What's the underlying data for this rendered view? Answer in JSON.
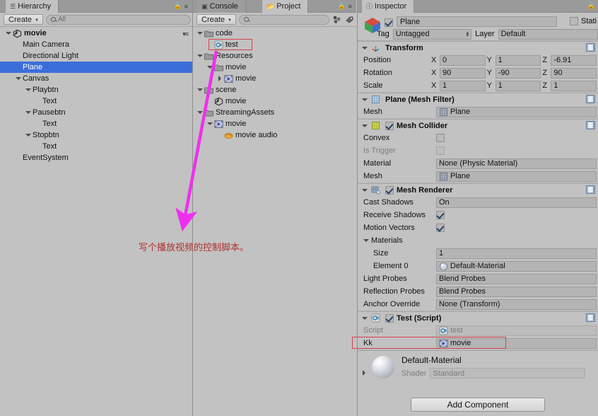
{
  "hierarchy": {
    "tab_label": "Hierarchy",
    "tab_icon": "hierarchy-icon",
    "create_label": "Create",
    "search_placeholder": "All",
    "search_value": "",
    "items": [
      {
        "label": "movie",
        "depth": 0,
        "arrow": "down",
        "icon": "scene-icon",
        "selected": false,
        "bold": true
      },
      {
        "label": "Main Camera",
        "depth": 1,
        "arrow": "none",
        "icon": "none",
        "selected": false,
        "bold": false
      },
      {
        "label": "Directional Light",
        "depth": 1,
        "arrow": "none",
        "icon": "none",
        "selected": false,
        "bold": false
      },
      {
        "label": "Plane",
        "depth": 1,
        "arrow": "none",
        "icon": "none",
        "selected": true,
        "bold": false
      },
      {
        "label": "Canvas",
        "depth": 1,
        "arrow": "down",
        "icon": "none",
        "selected": false,
        "bold": false
      },
      {
        "label": "Playbtn",
        "depth": 2,
        "arrow": "down",
        "icon": "none",
        "selected": false,
        "bold": false
      },
      {
        "label": "Text",
        "depth": 3,
        "arrow": "none",
        "icon": "none",
        "selected": false,
        "bold": false
      },
      {
        "label": "Pausebtn",
        "depth": 2,
        "arrow": "down",
        "icon": "none",
        "selected": false,
        "bold": false
      },
      {
        "label": "Text",
        "depth": 3,
        "arrow": "none",
        "icon": "none",
        "selected": false,
        "bold": false
      },
      {
        "label": "Stopbtn",
        "depth": 2,
        "arrow": "down",
        "icon": "none",
        "selected": false,
        "bold": false
      },
      {
        "label": "Text",
        "depth": 3,
        "arrow": "none",
        "icon": "none",
        "selected": false,
        "bold": false
      },
      {
        "label": "EventSystem",
        "depth": 1,
        "arrow": "none",
        "icon": "none",
        "selected": false,
        "bold": false
      }
    ]
  },
  "project": {
    "tabs": [
      {
        "label": "Console",
        "icon": "console-icon",
        "active": false
      },
      {
        "label": "Project",
        "icon": "project-icon",
        "active": true
      }
    ],
    "create_label": "Create",
    "search_placeholder": "",
    "items": [
      {
        "label": "code",
        "depth": 0,
        "arrow": "down",
        "icon": "folder-icon",
        "highlight": false
      },
      {
        "label": "test",
        "depth": 1,
        "arrow": "none",
        "icon": "csharp-script-icon",
        "highlight": true
      },
      {
        "label": "Resources",
        "depth": 0,
        "arrow": "down",
        "icon": "folder-icon",
        "highlight": false
      },
      {
        "label": "movie",
        "depth": 1,
        "arrow": "down",
        "icon": "folder-icon",
        "highlight": false
      },
      {
        "label": "movie",
        "depth": 2,
        "arrow": "right",
        "icon": "movie-texture-icon",
        "highlight": false
      },
      {
        "label": "scene",
        "depth": 0,
        "arrow": "down",
        "icon": "folder-icon",
        "highlight": false
      },
      {
        "label": "movie",
        "depth": 1,
        "arrow": "none",
        "icon": "scene-icon",
        "highlight": false
      },
      {
        "label": "StreamingAssets",
        "depth": 0,
        "arrow": "down",
        "icon": "folder-icon",
        "highlight": false
      },
      {
        "label": "movie",
        "depth": 1,
        "arrow": "down",
        "icon": "movie-texture-icon",
        "highlight": false
      },
      {
        "label": "movie audio",
        "depth": 2,
        "arrow": "none",
        "icon": "audio-clip-icon",
        "highlight": false
      }
    ]
  },
  "inspector": {
    "tab_label": "Inspector",
    "tab_icon": "inspector-icon",
    "object_name": "Plane",
    "object_enabled": true,
    "static_label": "Stati",
    "static_checked": false,
    "tag_label": "Tag",
    "tag_value": "Untagged",
    "layer_label": "Layer",
    "layer_value": "Default",
    "components": [
      {
        "title": "Transform",
        "icon": "transform-icon",
        "has_checkbox": false,
        "rows": [
          {
            "type": "vector3",
            "label": "Position",
            "x": "0",
            "y": "1",
            "z": "-6.91"
          },
          {
            "type": "vector3",
            "label": "Rotation",
            "x": "90",
            "y": "-90",
            "z": "90"
          },
          {
            "type": "vector3",
            "label": "Scale",
            "x": "1",
            "y": "1",
            "z": "1"
          }
        ]
      },
      {
        "title": "Plane (Mesh Filter)",
        "icon": "mesh-filter-icon",
        "has_checkbox": false,
        "rows": [
          {
            "type": "object",
            "label": "Mesh",
            "value": "Plane",
            "value_icon": "mesh-icon"
          }
        ]
      },
      {
        "title": "Mesh Collider",
        "icon": "mesh-collider-icon",
        "has_checkbox": true,
        "checked": true,
        "rows": [
          {
            "type": "checkbox",
            "label": "Convex",
            "checked": false
          },
          {
            "type": "checkbox",
            "label": "Is Trigger",
            "checked": false,
            "dim": true
          },
          {
            "type": "object",
            "label": "Material",
            "value": "None (Physic Material)",
            "value_icon": "none"
          },
          {
            "type": "object",
            "label": "Mesh",
            "value": "Plane",
            "value_icon": "mesh-icon"
          }
        ]
      },
      {
        "title": "Mesh Renderer",
        "icon": "mesh-renderer-icon",
        "has_checkbox": true,
        "checked": true,
        "rows": [
          {
            "type": "dropdown",
            "label": "Cast Shadows",
            "value": "On"
          },
          {
            "type": "checkbox",
            "label": "Receive Shadows",
            "checked": true
          },
          {
            "type": "checkbox",
            "label": "Motion Vectors",
            "checked": true
          },
          {
            "type": "foldout",
            "label": "Materials",
            "arrow": "down"
          },
          {
            "type": "text",
            "label": "Size",
            "value": "1",
            "indent": true
          },
          {
            "type": "object",
            "label": "Element 0",
            "value": "Default-Material",
            "value_icon": "material-icon",
            "indent": true
          },
          {
            "type": "dropdown",
            "label": "Light Probes",
            "value": "Blend Probes"
          },
          {
            "type": "dropdown",
            "label": "Reflection Probes",
            "value": "Blend Probes"
          },
          {
            "type": "object",
            "label": "Anchor Override",
            "value": "None (Transform)",
            "value_icon": "none"
          }
        ]
      },
      {
        "title": "Test (Script)",
        "icon": "csharp-script-icon",
        "has_checkbox": true,
        "checked": true,
        "rows": [
          {
            "type": "object",
            "label": "Script",
            "value": "test",
            "value_icon": "csharp-script-icon",
            "ghost": true
          },
          {
            "type": "object",
            "label": "Kk",
            "value": "movie",
            "value_icon": "movie-texture-icon",
            "highlight": true
          }
        ]
      }
    ],
    "material_preview": {
      "name": "Default-Material",
      "shader_label": "Shader",
      "shader_value": "Standard"
    },
    "add_component_label": "Add Component"
  },
  "annotation": {
    "text": "写个播放视频的控制脚本。",
    "color": "#b03030",
    "arrow_color": "#ee30ee"
  }
}
